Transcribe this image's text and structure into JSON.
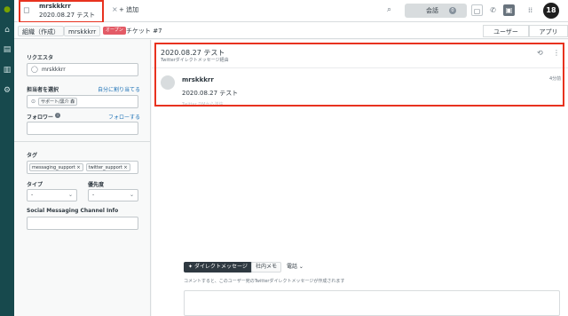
{
  "top_tab": {
    "title": "mrskkkrr",
    "subtitle": "2020.08.27 テスト",
    "close": "×",
    "add_label": "+ 追加"
  },
  "topbar": {
    "conversations_label": "会話",
    "conversations_count": "0",
    "profile_initials": "18"
  },
  "breadcrumbs": [
    "組織（作成）",
    "mrskkkrr"
  ],
  "ticket": {
    "status": "オープン",
    "label": "チケット #7"
  },
  "sub_tabs": [
    "ユーザー",
    "アプリ"
  ],
  "sidebar": {
    "requester_label": "リクエスタ",
    "requester_value": "mrskkkrr",
    "assignee_label": "担当者を選択",
    "assign_me_link": "自分に割り当てる",
    "assignee_value": "サポート/黒介 森",
    "followers_label": "フォロワー",
    "follow_link": "フォローする",
    "tags_label": "タグ",
    "tags": [
      "messaging_support",
      "twitter_support"
    ],
    "type_label": "タイプ",
    "type_value": "-",
    "priority_label": "優先度",
    "priority_value": "-",
    "smc_label": "Social Messaging Channel Info"
  },
  "conversation": {
    "title": "2020.08.27 テスト",
    "via": "Twitterダイレクトメッセージ経由",
    "message": {
      "author": "mrskkkrr",
      "time": "4分前",
      "text": "2020.08.27 テスト",
      "faint": "Twitter DMから送信"
    }
  },
  "composer": {
    "channel_label": "ダイレクトメッセージ",
    "note_label": "社内メモ",
    "phone_label": "電話",
    "hint": "コメントすると、このユーザー宛のTwitterダイレクトメッセージが作成されます"
  },
  "colors": {
    "highlight": "#e8321f",
    "rail": "#17494d",
    "status_open": "#e35b66",
    "link": "#1f73b7"
  }
}
